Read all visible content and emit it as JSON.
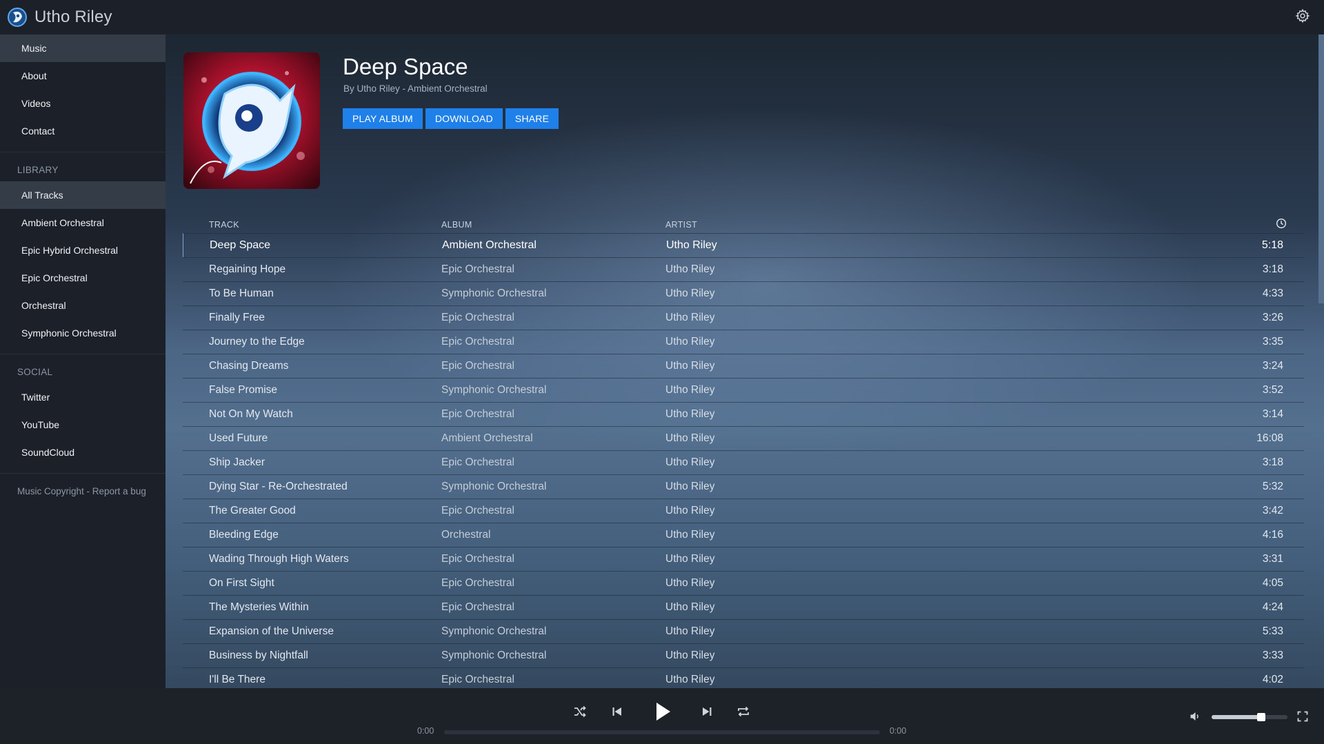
{
  "app": {
    "title": "Utho Riley"
  },
  "sidebar": {
    "nav": [
      {
        "label": "Music",
        "active": true
      },
      {
        "label": "About",
        "active": false
      },
      {
        "label": "Videos",
        "active": false
      },
      {
        "label": "Contact",
        "active": false
      }
    ],
    "library": {
      "heading": "LIBRARY",
      "items": [
        {
          "label": "All Tracks",
          "active": true
        },
        {
          "label": "Ambient Orchestral",
          "active": false
        },
        {
          "label": "Epic Hybrid Orchestral",
          "active": false
        },
        {
          "label": "Epic Orchestral",
          "active": false
        },
        {
          "label": "Orchestral",
          "active": false
        },
        {
          "label": "Symphonic Orchestral",
          "active": false
        }
      ]
    },
    "social": {
      "heading": "SOCIAL",
      "items": [
        {
          "label": "Twitter"
        },
        {
          "label": "YouTube"
        },
        {
          "label": "SoundCloud"
        }
      ]
    },
    "footer": {
      "copyright": "Music Copyright",
      "separator": " - ",
      "report": "Report a bug"
    }
  },
  "album": {
    "title": "Deep Space",
    "subtitle": "By Utho Riley - Ambient Orchestral",
    "buttons": {
      "play": "PLAY ALBUM",
      "download": "DOWNLOAD",
      "share": "SHARE"
    }
  },
  "table": {
    "headers": {
      "track": "TRACK",
      "album": "ALBUM",
      "artist": "ARTIST",
      "duration_icon": "clock-icon"
    },
    "rows": [
      {
        "track": "Deep Space",
        "album": "Ambient Orchestral",
        "artist": "Utho Riley",
        "duration": "5:18",
        "current": true
      },
      {
        "track": "Regaining Hope",
        "album": "Epic Orchestral",
        "artist": "Utho Riley",
        "duration": "3:18"
      },
      {
        "track": "To Be Human",
        "album": "Symphonic Orchestral",
        "artist": "Utho Riley",
        "duration": "4:33"
      },
      {
        "track": "Finally Free",
        "album": "Epic Orchestral",
        "artist": "Utho Riley",
        "duration": "3:26"
      },
      {
        "track": "Journey to the Edge",
        "album": "Epic Orchestral",
        "artist": "Utho Riley",
        "duration": "3:35"
      },
      {
        "track": "Chasing Dreams",
        "album": "Epic Orchestral",
        "artist": "Utho Riley",
        "duration": "3:24"
      },
      {
        "track": "False Promise",
        "album": "Symphonic Orchestral",
        "artist": "Utho Riley",
        "duration": "3:52"
      },
      {
        "track": "Not On My Watch",
        "album": "Epic Orchestral",
        "artist": "Utho Riley",
        "duration": "3:14"
      },
      {
        "track": "Used Future",
        "album": "Ambient Orchestral",
        "artist": "Utho Riley",
        "duration": "16:08"
      },
      {
        "track": "Ship Jacker",
        "album": "Epic Orchestral",
        "artist": "Utho Riley",
        "duration": "3:18"
      },
      {
        "track": "Dying Star - Re-Orchestrated",
        "album": "Symphonic Orchestral",
        "artist": "Utho Riley",
        "duration": "5:32"
      },
      {
        "track": "The Greater Good",
        "album": "Epic Orchestral",
        "artist": "Utho Riley",
        "duration": "3:42"
      },
      {
        "track": "Bleeding Edge",
        "album": "Orchestral",
        "artist": "Utho Riley",
        "duration": "4:16"
      },
      {
        "track": "Wading Through High Waters",
        "album": "Epic Orchestral",
        "artist": "Utho Riley",
        "duration": "3:31"
      },
      {
        "track": "On First Sight",
        "album": "Epic Orchestral",
        "artist": "Utho Riley",
        "duration": "4:05"
      },
      {
        "track": "The Mysteries Within",
        "album": "Epic Orchestral",
        "artist": "Utho Riley",
        "duration": "4:24"
      },
      {
        "track": "Expansion of the Universe",
        "album": "Symphonic Orchestral",
        "artist": "Utho Riley",
        "duration": "5:33"
      },
      {
        "track": "Business by Nightfall",
        "album": "Symphonic Orchestral",
        "artist": "Utho Riley",
        "duration": "3:33"
      },
      {
        "track": "I'll Be There",
        "album": "Epic Orchestral",
        "artist": "Utho Riley",
        "duration": "4:02"
      }
    ]
  },
  "player": {
    "time_elapsed": "0:00",
    "time_total": "0:00",
    "progress": 0,
    "volume": 0.65,
    "icons": [
      "shuffle-icon",
      "previous-icon",
      "play-icon",
      "next-icon",
      "repeat-icon",
      "volume-icon",
      "fullscreen-icon"
    ]
  },
  "colors": {
    "accent": "#1f80ea",
    "sidebar_bg": "#1c2129",
    "active_item": "#343c48"
  }
}
